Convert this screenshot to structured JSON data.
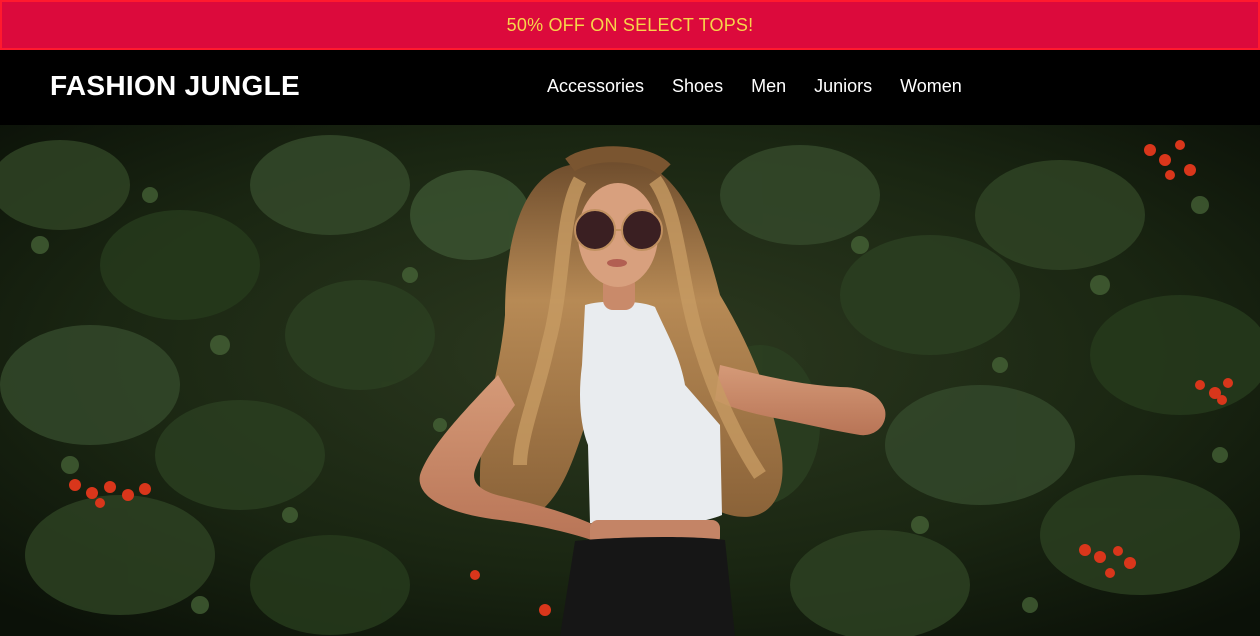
{
  "promo": {
    "text": "50% OFF ON SELECT TOPS!"
  },
  "header": {
    "logo": "FASHION JUNGLE",
    "nav": [
      "Accessories",
      "Shoes",
      "Men",
      "Juniors",
      "Women"
    ]
  },
  "hero": {
    "image_icon": "fashion-model-photo"
  },
  "colors": {
    "promo_bg": "#dc0a3c",
    "promo_text": "#f7d54a",
    "header_bg": "#000000"
  }
}
